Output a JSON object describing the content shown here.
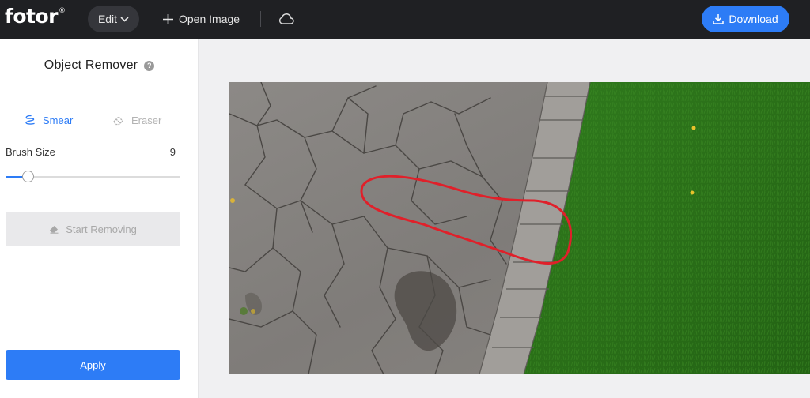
{
  "app": {
    "logo": "fotor",
    "logo_mark": "®"
  },
  "topbar": {
    "edit_label": "Edit",
    "open_image_label": "Open Image",
    "download_label": "Download"
  },
  "panel": {
    "title": "Object Remover",
    "help_glyph": "?",
    "tabs": [
      {
        "label": "Smear",
        "active": true
      },
      {
        "label": "Eraser",
        "active": false
      }
    ],
    "brush_size_label": "Brush Size",
    "brush_size_value": "9",
    "brush_size_fraction": 0.1,
    "start_removing_label": "Start Removing",
    "apply_label": "Apply"
  },
  "colors": {
    "accent": "#2d7cf6",
    "topbar_bg": "#1f2023",
    "stroke": "#e0202a"
  },
  "icons": {
    "edit_chevron": "chevron-down-icon",
    "open": "plus-icon",
    "cloud": "cloud-icon",
    "download": "download-icon",
    "help": "question-icon",
    "smear": "smear-brush-icon",
    "eraser": "eraser-icon",
    "start_removing": "eraser-icon"
  }
}
